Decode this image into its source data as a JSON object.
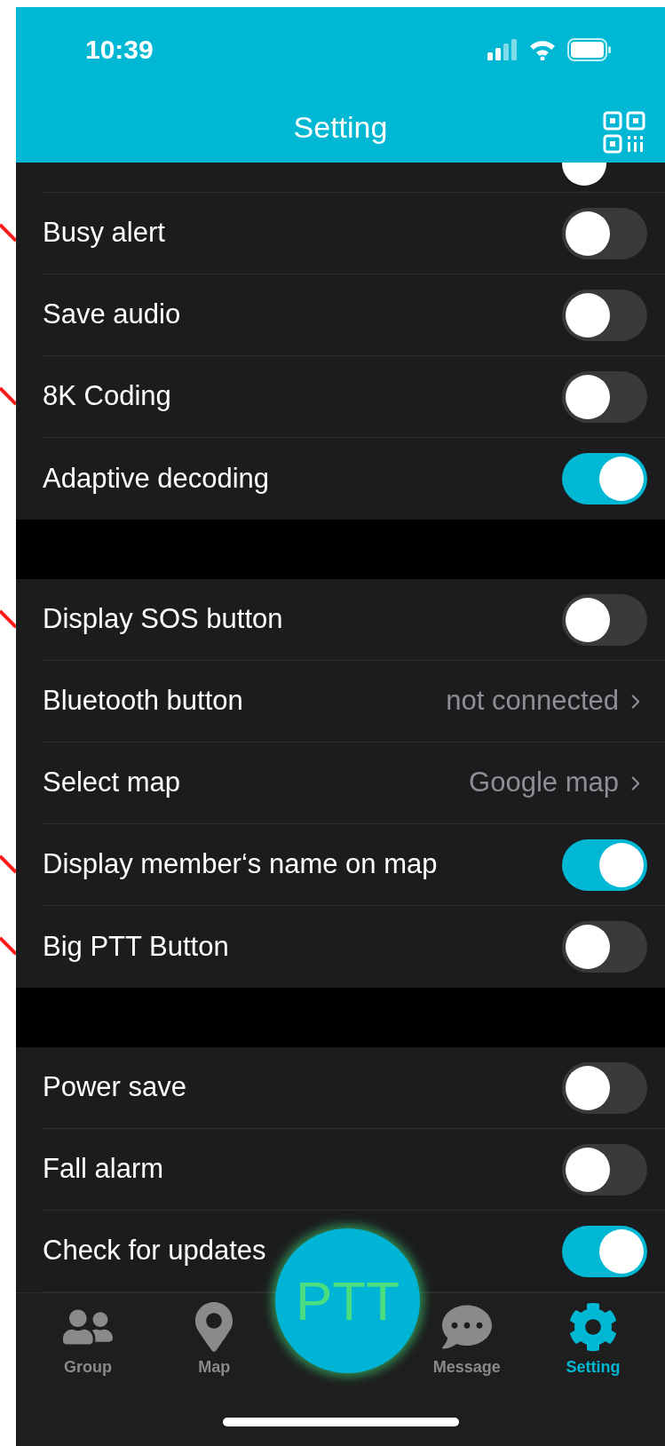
{
  "status_bar": {
    "time": "10:39"
  },
  "header": {
    "title": "Setting"
  },
  "sections": [
    {
      "rows": [
        {
          "kind": "toggle",
          "label": "Busy alert",
          "on": false,
          "marked": true
        },
        {
          "kind": "toggle",
          "label": "Save audio",
          "on": false,
          "marked": false
        },
        {
          "kind": "toggle",
          "label": "8K Coding",
          "on": false,
          "marked": true
        },
        {
          "kind": "toggle",
          "label": "Adaptive decoding",
          "on": true,
          "marked": false
        }
      ]
    },
    {
      "rows": [
        {
          "kind": "toggle",
          "label": "Display SOS button",
          "on": false,
          "marked": true
        },
        {
          "kind": "link",
          "label": "Bluetooth button",
          "value": "not connected",
          "marked": false
        },
        {
          "kind": "link",
          "label": "Select map",
          "value": "Google map",
          "marked": false
        },
        {
          "kind": "toggle",
          "label": "Display member‘s name on map",
          "on": true,
          "marked": true
        },
        {
          "kind": "toggle",
          "label": "Big PTT Button",
          "on": false,
          "marked": true
        }
      ]
    },
    {
      "rows": [
        {
          "kind": "toggle",
          "label": "Power save",
          "on": false,
          "marked": false
        },
        {
          "kind": "toggle",
          "label": "Fall alarm",
          "on": false,
          "marked": false
        },
        {
          "kind": "toggle",
          "label": "Check for updates",
          "on": true,
          "marked": false
        }
      ]
    }
  ],
  "ptt_button": {
    "label": "PTT"
  },
  "tab_bar": [
    {
      "label": "Group",
      "selected": false
    },
    {
      "label": "Map",
      "selected": false
    },
    {
      "label": "Message",
      "selected": false
    },
    {
      "label": "Setting",
      "selected": true
    }
  ]
}
